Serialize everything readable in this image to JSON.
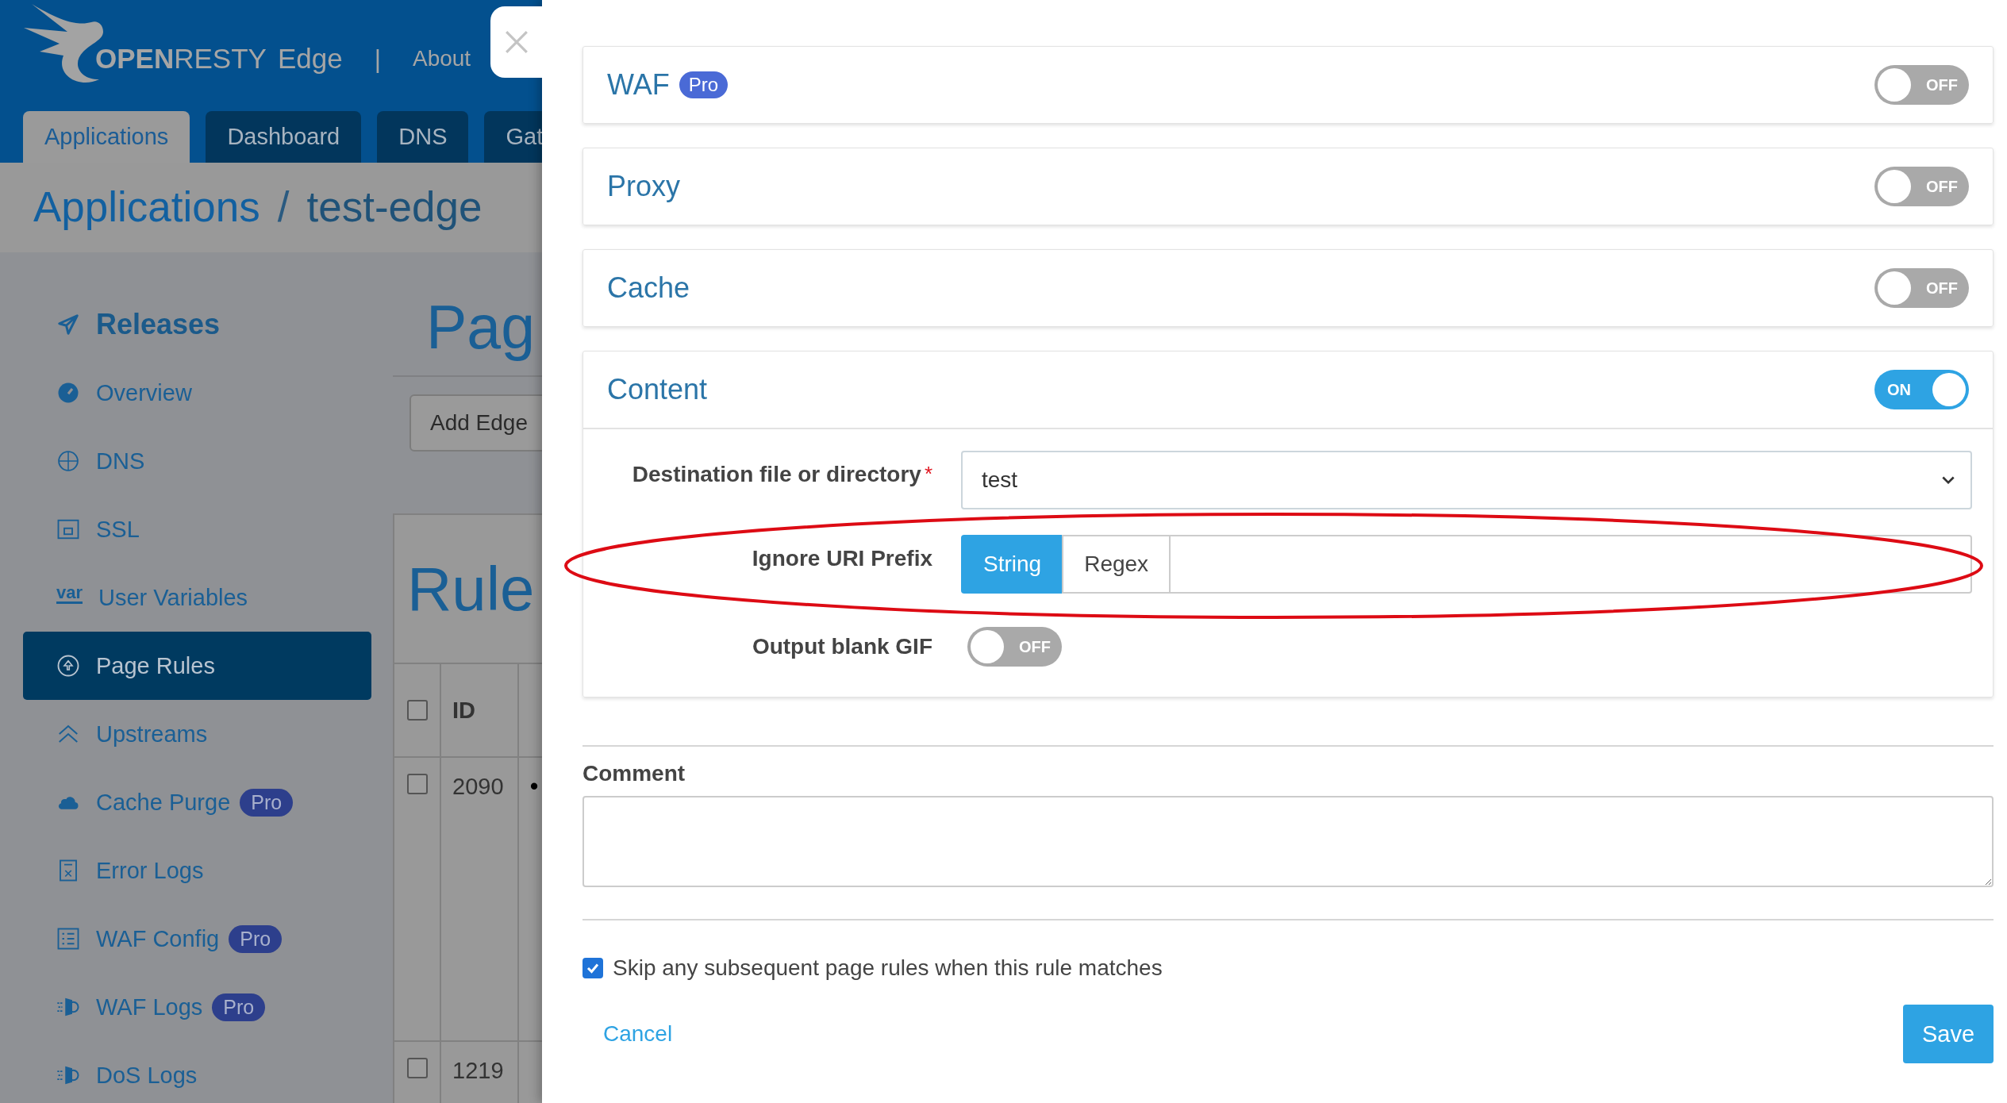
{
  "app": {
    "logo": {
      "brand": "**OPEN**RESTY",
      "product": "Edge"
    },
    "separator": "|",
    "nav_links": [
      "About"
    ],
    "tabs": [
      {
        "label": "Applications",
        "selected": true
      },
      {
        "label": "Dashboard",
        "selected": false
      },
      {
        "label": "DNS",
        "selected": false
      },
      {
        "label": "Gat",
        "selected": false
      }
    ],
    "breadcrumb": [
      "Applications",
      "/",
      "test-edge"
    ],
    "sidebar": {
      "items": [
        {
          "label": "Releases",
          "kind": "heading",
          "selected": false
        },
        {
          "label": "Overview",
          "kind": "link",
          "selected": false
        },
        {
          "label": "DNS",
          "kind": "link",
          "selected": false
        },
        {
          "label": "SSL",
          "kind": "link",
          "selected": false
        },
        {
          "label": "User Variables",
          "kind": "link",
          "icon_text": "var",
          "selected": false
        },
        {
          "label": "Page Rules",
          "kind": "link",
          "selected": true
        },
        {
          "label": "Upstreams",
          "kind": "link",
          "selected": false
        },
        {
          "label": "Cache Purge",
          "kind": "link",
          "badge": "Pro",
          "selected": false
        },
        {
          "label": "Error Logs",
          "kind": "link",
          "selected": false
        },
        {
          "label": "WAF Config",
          "kind": "link",
          "badge": "Pro",
          "selected": false
        },
        {
          "label": "WAF Logs",
          "kind": "link",
          "badge": "Pro",
          "selected": false
        },
        {
          "label": "DoS Logs",
          "kind": "link",
          "selected": false
        }
      ]
    },
    "page_title": "Pag",
    "toolbar_button": "Add Edge",
    "rules": {
      "title": "Rule",
      "header_checked": false,
      "columns": [
        "ID"
      ],
      "rows": [
        {
          "checked": false,
          "id": "2090",
          "column_3": "•"
        },
        {
          "checked": false,
          "id": "1219"
        }
      ]
    }
  },
  "drawer": {
    "sections": [
      {
        "title": "WAF",
        "badge": "Pro",
        "on": false,
        "toggle_text": "OFF"
      },
      {
        "title": "Proxy",
        "on": false,
        "toggle_text": "OFF"
      },
      {
        "title": "Cache",
        "on": false,
        "toggle_text": "OFF"
      },
      {
        "title": "Content",
        "on": true,
        "toggle_text": "ON",
        "fields": [
          {
            "kind": "select",
            "label": "Destination file or directory",
            "required_mark": "*",
            "value": "test"
          },
          {
            "kind": "segmented",
            "label": "Ignore URI Prefix",
            "options": [
              {
                "label": "String",
                "selected": true
              },
              {
                "label": "Regex",
                "selected": false
              }
            ]
          },
          {
            "kind": "toggle",
            "label": "Output blank GIF",
            "on": false,
            "toggle_text": "OFF"
          }
        ]
      }
    ],
    "comment": {
      "label": "Comment"
    },
    "skip_rules": {
      "label": "Skip any subsequent page rules when this rule matches",
      "checked": true
    },
    "cancel": "Cancel",
    "save": "Save",
    "annotation": {
      "kind": "ellipse"
    }
  }
}
